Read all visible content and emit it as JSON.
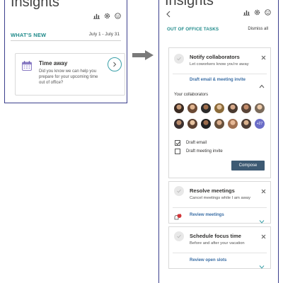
{
  "left": {
    "title": "Insights",
    "icons": [
      "chart-icon",
      "gear-icon",
      "smiley-icon"
    ],
    "whats_new": "WHAT'S NEW",
    "date_range": "July 1 - July 31",
    "card": {
      "title": "Time away",
      "body": "Did you know we can help you prepare for your upcoming time out of office?",
      "icon": "calendar-icon",
      "action_icon": "chevron-right-icon"
    }
  },
  "right": {
    "title": "Insights",
    "icons": [
      "chart-icon",
      "gear-icon",
      "smiley-icon"
    ],
    "section_title": "OUT OF OFFICE TASKS",
    "dismiss_all": "Dismiss all",
    "tasks": [
      {
        "title": "Notify collaborators",
        "subtitle": "Let coworkers know you're away",
        "link": "Draft email & meeting invite",
        "expanded": true,
        "collaborators_label": "Your collaborators",
        "more_count": "+27",
        "options": [
          {
            "label": "Draft email",
            "checked": true
          },
          {
            "label": "Draft meeting invite",
            "checked": false
          }
        ],
        "button": "Compose"
      },
      {
        "title": "Resolve meetings",
        "subtitle": "Cancel meetings while I am away",
        "link": "Review meetings",
        "badge": "1",
        "expanded": false
      },
      {
        "title": "Schedule focus time",
        "subtitle": "Before and after your vacation",
        "link": "Review open slots",
        "expanded": false
      }
    ]
  },
  "colors": {
    "accent_teal": "#1f8a8a",
    "link_blue": "#3a6ea5",
    "frame_navy": "#3b3f8c",
    "button_dark": "#3d5a73",
    "more_avatar": "#6b6dc7",
    "badge_red": "#d13438"
  }
}
